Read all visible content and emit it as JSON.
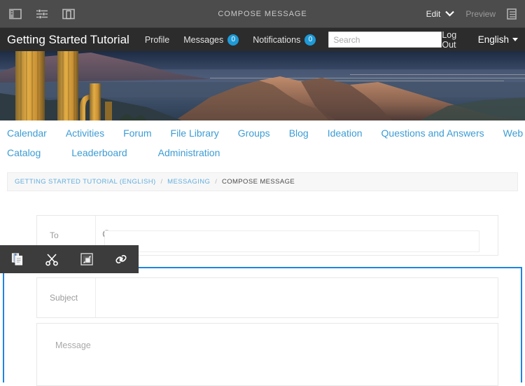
{
  "editor_bar": {
    "title": "COMPOSE MESSAGE",
    "icons": [
      {
        "name": "panel-layout-icon",
        "label": "Panel"
      },
      {
        "name": "sliders-settings-icon",
        "label": "Settings"
      },
      {
        "name": "device-preview-icon",
        "label": "Device"
      }
    ],
    "edit_label": "Edit",
    "preview_label": "Preview",
    "right_icon_name": "pages-icon"
  },
  "site_header": {
    "title": "Getting Started Tutorial",
    "nav": [
      {
        "label": "Profile",
        "badge": null
      },
      {
        "label": "Messages",
        "badge": "0"
      },
      {
        "label": "Notifications",
        "badge": "0"
      }
    ],
    "search_placeholder": "Search",
    "search_value": "",
    "logout_label": "Log Out",
    "language_label": "English"
  },
  "main_nav": {
    "row1": [
      "Calendar",
      "Activities",
      "Forum",
      "File Library",
      "Groups",
      "Blog",
      "Ideation",
      "Questions and Answers",
      "Web Page"
    ],
    "row2": [
      "Catalog",
      "Leaderboard",
      "Administration"
    ]
  },
  "breadcrumb": {
    "items": [
      "GETTING STARTED TUTORIAL (ENGLISH)",
      "MESSAGING"
    ],
    "separator": "/",
    "current": "COMPOSE MESSAGE"
  },
  "compose_form": {
    "to_label": "To",
    "to_value": "",
    "to_search_icon": "search-icon",
    "subject_label": "Subject",
    "subject_value": "",
    "message_placeholder": "Message",
    "message_value": ""
  },
  "context_toolbar": {
    "buttons": [
      {
        "name": "copy-icon",
        "label": "Copy"
      },
      {
        "name": "cut-scissors-icon",
        "label": "Cut"
      },
      {
        "name": "paste-frame-icon",
        "label": "Paste"
      },
      {
        "name": "link-chain-icon",
        "label": "Link"
      }
    ]
  },
  "colors": {
    "editor_bar_bg": "#4c4c4c",
    "site_header_bg": "#2c2c2c",
    "accent_blue": "#1e9ad6",
    "link_blue": "#3c9cd4",
    "selection_blue": "#1f84e0",
    "toolbar_bg": "#3c3c3c"
  }
}
